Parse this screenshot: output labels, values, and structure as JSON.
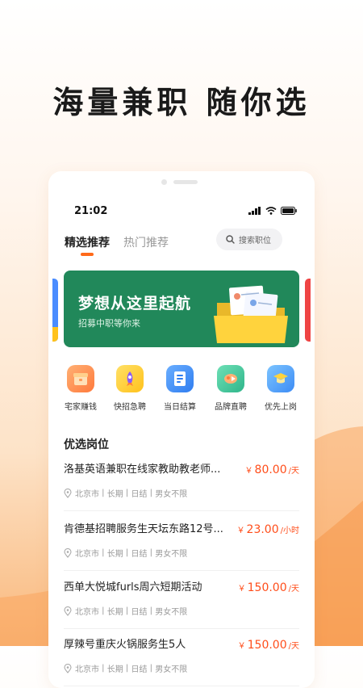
{
  "headline": "海量兼职 随你选",
  "phone": {
    "status": {
      "time": "21:02"
    },
    "tabs": [
      {
        "label": "精选推荐",
        "active": true
      },
      {
        "label": "热门推荐",
        "active": false
      }
    ],
    "search": {
      "placeholder": "搜索职位"
    },
    "banner": {
      "title": "梦想从这里起航",
      "subtitle": "招募中职等你来",
      "color": "#21885a"
    },
    "quick_links": [
      {
        "label": "宅家赚钱",
        "icon": "home-box-icon",
        "color": "#ff8a4c"
      },
      {
        "label": "快招急聘",
        "icon": "rocket-icon",
        "color": "#ffc928"
      },
      {
        "label": "当日结算",
        "icon": "document-icon",
        "color": "#3d8cf5"
      },
      {
        "label": "品牌直聘",
        "icon": "brand-tag-icon",
        "color": "#3fc59a"
      },
      {
        "label": "优先上岗",
        "icon": "graduation-cap-icon",
        "color": "#4aa8ff"
      }
    ],
    "section_title": "优选岗位",
    "jobs": [
      {
        "title": "洛基英语兼职在线家教助教老师...",
        "currency": "￥",
        "price": "80.00",
        "unit": "/天",
        "location": "北京市",
        "term": "长期",
        "settlement": "日结",
        "gender": "男女不限"
      },
      {
        "title": "肯德基招聘服务生天坛东路12号...",
        "currency": "￥",
        "price": "23.00",
        "unit": "/小时",
        "location": "北京市",
        "term": "长期",
        "settlement": "日结",
        "gender": "男女不限"
      },
      {
        "title": "西单大悦城furls周六短期活动",
        "currency": "￥",
        "price": "150.00",
        "unit": "/天",
        "location": "北京市",
        "term": "长期",
        "settlement": "日结",
        "gender": "男女不限"
      },
      {
        "title": "厚辣号重庆火锅服务生5人",
        "currency": "￥",
        "price": "150.00",
        "unit": "/天",
        "location": "北京市",
        "term": "长期",
        "settlement": "日结",
        "gender": "男女不限"
      }
    ],
    "accent_color": "#ff6a1a",
    "price_color": "#ff4d1a"
  }
}
